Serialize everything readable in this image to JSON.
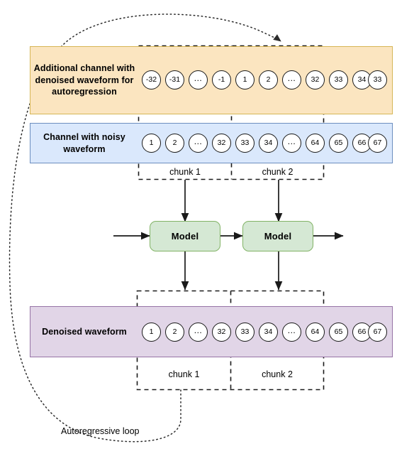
{
  "diagram": {
    "title": "Autoregressive denoising chunked waveform diagram",
    "colors": {
      "additional_channel_fill": "#fbe5c0",
      "additional_channel_stroke": "#d6b656",
      "noisy_channel_fill": "#dae8fc",
      "noisy_channel_stroke": "#6c8ebf",
      "denoised_fill": "#e1d5e7",
      "denoised_stroke": "#9673a6",
      "model_fill": "#d5e8d4",
      "model_stroke": "#82b366",
      "line": "#1a1a1a"
    },
    "rows": [
      {
        "id": "additional-channel",
        "label": "Additional channel with denoised waveform for autoregression",
        "tokens": [
          "-32",
          "-31",
          "...",
          "-1",
          "1",
          "2",
          "...",
          "32",
          "33",
          "34",
          "33"
        ]
      },
      {
        "id": "noisy-channel",
        "label": "Channel with noisy waveform",
        "tokens": [
          "1",
          "2",
          "...",
          "32",
          "33",
          "34",
          "...",
          "64",
          "65",
          "66",
          "67"
        ]
      },
      {
        "id": "denoised-waveform",
        "label": "Denoised waveform",
        "tokens": [
          "1",
          "2",
          "...",
          "32",
          "33",
          "34",
          "...",
          "64",
          "65",
          "66",
          "67"
        ]
      }
    ],
    "chunk_labels_top": [
      "chunk 1",
      "chunk 2"
    ],
    "chunk_labels_bottom": [
      "chunk 1",
      "chunk 2"
    ],
    "models": [
      "Model",
      "Model"
    ],
    "loop_label": "Autoregressive loop"
  }
}
